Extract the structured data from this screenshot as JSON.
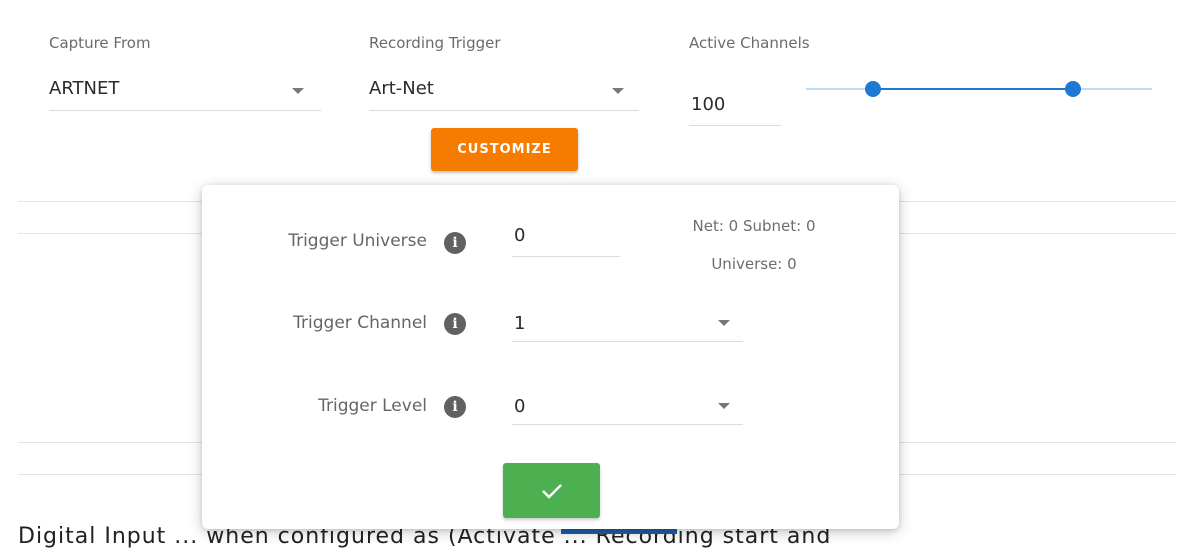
{
  "capture_from": {
    "label": "Capture From",
    "value": "ARTNET"
  },
  "recording_trigger": {
    "label": "Recording Trigger",
    "value": "Art-Net"
  },
  "active_channels": {
    "label": "Active Channels",
    "value": "100"
  },
  "customize_button": {
    "label": "CUSTOMIZE"
  },
  "popover": {
    "trigger_universe": {
      "label": "Trigger Universe",
      "value": "0",
      "note_line1": "Net: 0 Subnet: 0",
      "note_line2": "Universe: 0"
    },
    "trigger_channel": {
      "label": "Trigger Channel",
      "value": "1"
    },
    "trigger_level": {
      "label": "Trigger Level",
      "value": "0"
    },
    "confirm_icon": "check-icon"
  },
  "footer": {
    "text": "Digital Input ... when configured as (Activate ... Recording start and"
  },
  "colors": {
    "accent_orange": "#f57c00",
    "confirm_green": "#4caf50",
    "slider_blue": "#1e78d4"
  }
}
